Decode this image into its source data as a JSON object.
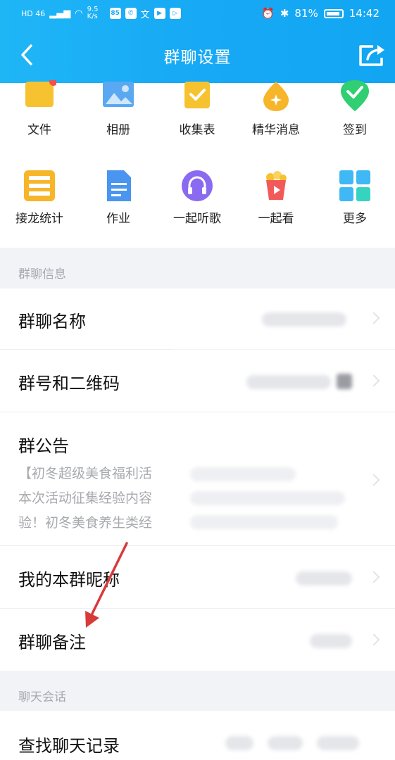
{
  "status_bar": {
    "left_text": "HD 46",
    "speed": "9.5 K/s",
    "battery": "81%",
    "time": "14:42"
  },
  "header": {
    "title": "群聊设置",
    "back_icon": "back-chevron-icon",
    "share_icon": "share-icon"
  },
  "tools": [
    {
      "label": "文件",
      "icon": "folder-icon",
      "color": "#f7c230"
    },
    {
      "label": "相册",
      "icon": "photo-album-icon",
      "color": "#5aa8f2"
    },
    {
      "label": "收集表",
      "icon": "checklist-icon",
      "color": "#f7c230"
    },
    {
      "label": "精华消息",
      "icon": "essence-drop-icon",
      "color": "#f7b52a"
    },
    {
      "label": "签到",
      "icon": "check-in-icon",
      "color": "#2fcf72"
    },
    {
      "label": "接龙统计",
      "icon": "relay-list-icon",
      "color": "#f7b52a"
    },
    {
      "label": "作业",
      "icon": "document-icon",
      "color": "#4a95ef"
    },
    {
      "label": "一起听歌",
      "icon": "headphones-icon",
      "color": "#8a6af0"
    },
    {
      "label": "一起看",
      "icon": "popcorn-icon",
      "color": "#f25a5a"
    },
    {
      "label": "更多",
      "icon": "grid-more-icon",
      "color": "#3fb8f5"
    }
  ],
  "sections": {
    "group_info": "群聊信息",
    "chat": "聊天会话"
  },
  "rows": {
    "group_name": "群聊名称",
    "group_id_qr": "群号和二维码",
    "announcement": "群公告",
    "announcement_lines": [
      "【初冬超级美食福利活",
      "本次活动征集经验内容",
      "验！初冬美食养生类经"
    ],
    "my_nickname": "我的本群昵称",
    "group_remark": "群聊备注",
    "search_history": "查找聊天记录"
  }
}
